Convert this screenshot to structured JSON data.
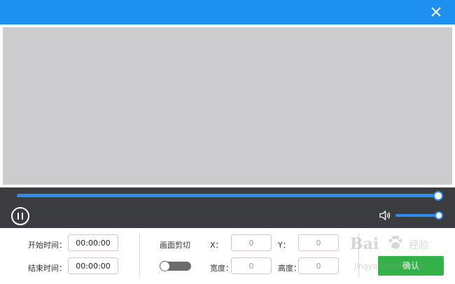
{
  "window": {
    "title": "",
    "close_icon": "close-icon",
    "accent_color": "#1e90f0"
  },
  "player": {
    "seek_progress": 1.0,
    "volume_level": 1.0,
    "state": "playing",
    "pause_icon": "pause-icon",
    "speaker_icon": "speaker-icon",
    "progress_color": "#2b8ef0"
  },
  "settings": {
    "start_time_label": "开始时间：",
    "start_time_value": "00:00:00",
    "end_time_label": "结束时间：",
    "end_time_value": "00:00:00",
    "crop_label": "画面剪切",
    "crop_enabled": false,
    "x_label": "X：",
    "x_value": "0",
    "y_label": "Y：",
    "y_value": "0",
    "width_label": "宽度：",
    "width_value": "0",
    "height_label": "高度：",
    "height_value": "0",
    "confirm_label": "确认",
    "confirm_color": "#34b24a"
  },
  "watermark": {
    "brand": "Bai",
    "brand_sub": "经验",
    "url": "jingyan.baidu.com"
  }
}
